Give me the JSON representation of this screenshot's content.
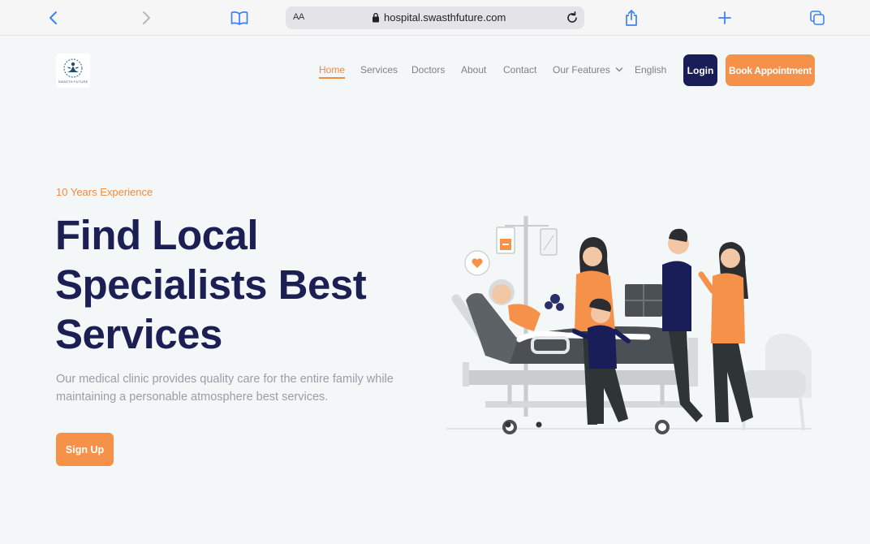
{
  "browser": {
    "url": "hospital.swasthfuture.com",
    "reader_label": "AA"
  },
  "site": {
    "logo_text": "SWASTH FUTURE",
    "nav": [
      {
        "label": "Home",
        "active": true
      },
      {
        "label": "Services"
      },
      {
        "label": "Doctors"
      },
      {
        "label": "About"
      },
      {
        "label": "Contact"
      },
      {
        "label": "Our Features"
      },
      {
        "label": "English"
      }
    ],
    "login_label": "Login",
    "book_label": "Book Appointment"
  },
  "hero": {
    "eyebrow": "10 Years Experience",
    "headline": "Find Local Specialists Best Services",
    "description": "Our medical clinic provides quality care for the entire family while maintaining a personable atmosphere best services.",
    "signup_label": "Sign Up"
  },
  "colors": {
    "accent_orange": "#f6914a",
    "navy": "#191e58",
    "background": "#f3f7f8"
  },
  "icons": [
    "back-icon",
    "forward-icon",
    "bookmarks-icon",
    "lock-icon",
    "reload-icon",
    "share-icon",
    "new-tab-icon",
    "tabs-icon",
    "chevron-down-icon"
  ]
}
